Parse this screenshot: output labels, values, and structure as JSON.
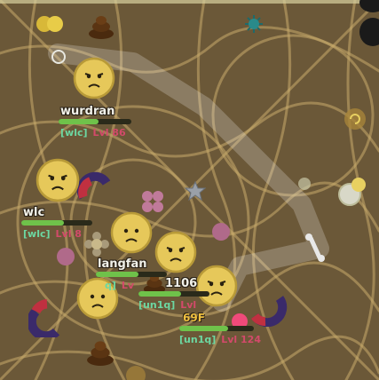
{
  "players": [
    {
      "id": "wurdran",
      "name": "wurdran",
      "team": "[wlc]",
      "level": "Lvl 86",
      "hp": 0.55
    },
    {
      "id": "wlc",
      "name": "wlc",
      "team": "[wlc]",
      "level": "Lvl 8",
      "hp": 0.6
    },
    {
      "id": "langfan",
      "name": "langfan",
      "team": "[un1q]",
      "level": "Lv",
      "hp": 0.6
    },
    {
      "id": "player-69f",
      "name": "69F",
      "team": "[un1q]",
      "level": "Lvl 124",
      "hp": 0.65
    }
  ],
  "labels": {
    "score_fragment": "1106",
    "fragment_a": "q]",
    "fragment_b": "[un1q]",
    "fragment_c": "Lvl"
  },
  "colors": {
    "ground": "#6b5838",
    "web": "#c9ab6c",
    "hp": "#6fc24a",
    "team": "#6cd8a2",
    "level": "#d24a6a",
    "petal_yellow": "#e8d060"
  },
  "icons": [
    "poop-icon",
    "star-icon",
    "magnet-icon",
    "bone-icon",
    "cactus-icon",
    "rose-icon",
    "pollen-icon",
    "light-icon"
  ]
}
